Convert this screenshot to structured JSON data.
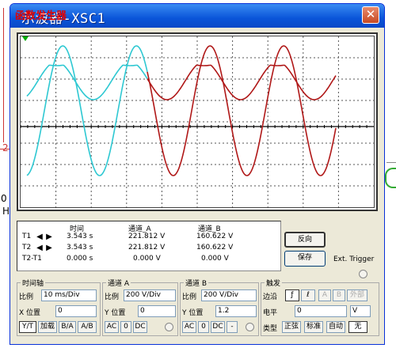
{
  "window": {
    "title": "示波器-XSC1",
    "title_ghost": "函数发生器",
    "close_label": "✕"
  },
  "background": {
    "left_labels": [
      "2",
      "0",
      "H"
    ]
  },
  "screen": {
    "background": "#ffffff",
    "channel_a_color": "#2ec8d2",
    "channel_b_color": "#b01818",
    "trigger_marker_color": "#00aa00"
  },
  "readout": {
    "headers": {
      "time": "时间",
      "channel_a": "通道_A",
      "channel_b": "通道_B"
    },
    "rows": [
      {
        "label": "T1",
        "time": "3.543 s",
        "a": "221.812 V",
        "b": "160.622 V"
      },
      {
        "label": "T2",
        "time": "3.543 s",
        "a": "221.812 V",
        "b": "160.622 V"
      },
      {
        "label": "T2-T1",
        "time": "0.000 s",
        "a": "0.000 V",
        "b": "0.000 V"
      }
    ],
    "arrow_left": "◀",
    "arrow_right": "▶"
  },
  "side": {
    "reverse_label": "反向",
    "save_label": "保存",
    "ext_trigger_label": "Ext. Trigger"
  },
  "timebase": {
    "title": "时间轴",
    "scale_label": "比例",
    "scale_value": "10 ms/Div",
    "pos_label": "X 位置",
    "pos_value": "0",
    "modes": [
      "Y/T",
      "加载",
      "B/A",
      "A/B"
    ]
  },
  "channel_a": {
    "title": "通道 A",
    "scale_label": "比例",
    "scale_value": "200 V/Div",
    "pos_label": "Y 位置",
    "pos_value": "0",
    "coupling": [
      "AC",
      "0",
      "DC"
    ]
  },
  "channel_b": {
    "title": "通道 B",
    "scale_label": "比例",
    "scale_value": "200 V/Div",
    "pos_label": "Y 位置",
    "pos_value": "1.2",
    "coupling": [
      "AC",
      "0",
      "DC",
      "-"
    ]
  },
  "trigger": {
    "title": "触发",
    "edge_label": "边沿",
    "edge_buttons": [
      "ƒ",
      "ℓ",
      "A",
      "B",
      "外部"
    ],
    "level_label": "电平",
    "level_value": "0",
    "level_unit": "V",
    "type_label": "类型",
    "type_buttons": [
      "正弦",
      "标准",
      "自动",
      "无"
    ]
  }
}
